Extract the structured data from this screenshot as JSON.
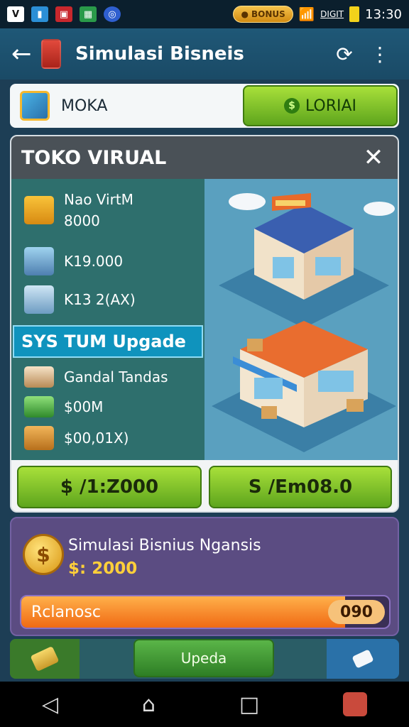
{
  "status_bar": {
    "coin_pill": "BONUS",
    "network": "DIGIT",
    "time": "13:30"
  },
  "app_bar": {
    "title": "Simulasi Bisneis"
  },
  "top_row": {
    "label": "MOKA",
    "login_label": "LORIAI"
  },
  "card": {
    "title": "TOKO VIRUAL",
    "stats": [
      {
        "line1": "Nao VirtM",
        "line2": "8000"
      },
      {
        "line1": "K19.000"
      },
      {
        "line1": "K13 2(AX)"
      }
    ],
    "upgrade_title": "SYS TUM Upgade",
    "items": [
      {
        "label": "Gandal Tandas"
      },
      {
        "label": "$00M"
      },
      {
        "label": "$00,01X)"
      }
    ],
    "btn_a": "$ /1:Z000",
    "btn_b": "S /Em08.0"
  },
  "panel": {
    "title": "Simulasi Bisnius Ngansis",
    "money": "$: 2000",
    "progress_label": "Rclanosc",
    "progress_value": "090",
    "progress_fraction": 0.88
  },
  "toolbar": {
    "middle_label": "Upeda"
  },
  "colors": {
    "accent_green": "#7cc72a",
    "panel_purple": "#5b4c82",
    "header_blue": "#1f5877"
  }
}
